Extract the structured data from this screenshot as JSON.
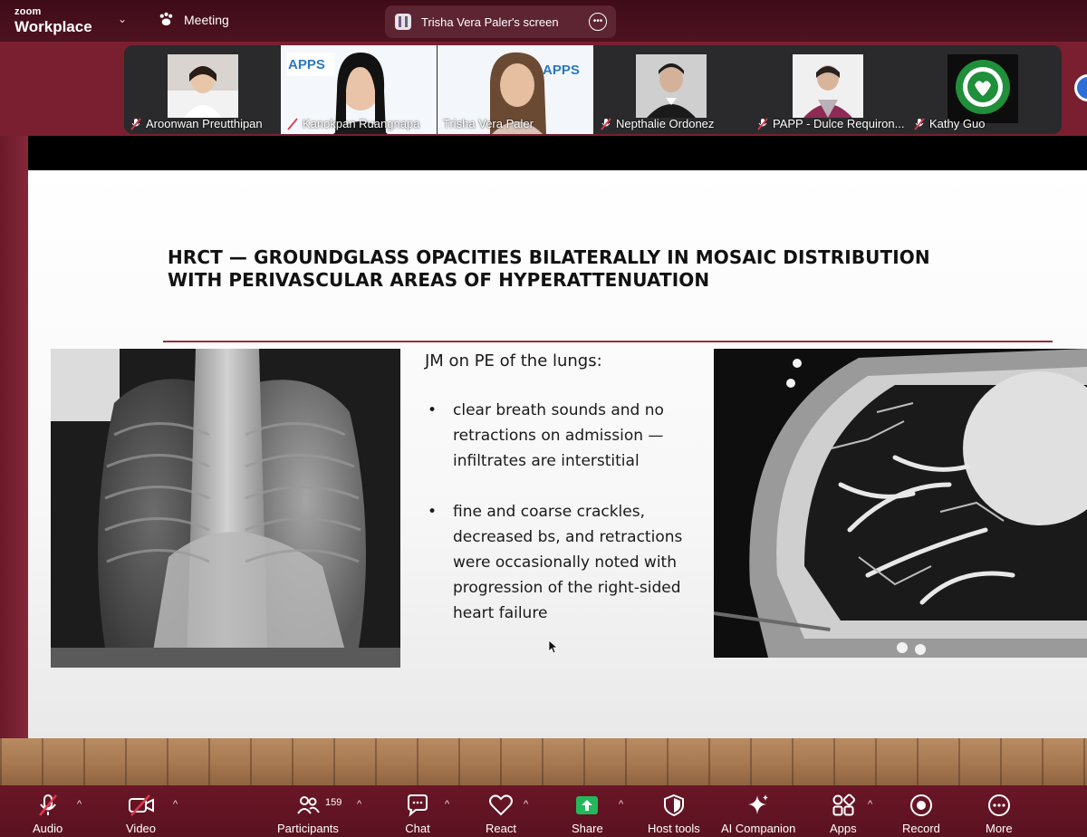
{
  "app": {
    "brand_top": "zoom",
    "brand_bottom": "Workplace",
    "meeting_label": "Meeting"
  },
  "share_banner": {
    "text": "Trisha Vera Paler's screen"
  },
  "participants_strip": [
    {
      "name": "Aroonwan Preutthipan",
      "muted": true
    },
    {
      "name": "Kanokpan Ruangnapa",
      "muted": true
    },
    {
      "name": "Trisha Vera Paler",
      "muted": false,
      "active_speaker": true
    },
    {
      "name": "Nepthalie Ordonez",
      "muted": true
    },
    {
      "name": "PAPP - Dulce Requiron...",
      "muted": true
    },
    {
      "name": "Kathy Guo",
      "muted": true
    }
  ],
  "slide": {
    "title_line1": "HRCT — GROUNDGLASS OPACITIES BILATERALLY IN MOSAIC DISTRIBUTION",
    "title_line2": "WITH PERIVASCULAR AREAS OF HYPERATTENUATION",
    "notes_heading": "JM on PE of the lungs:",
    "bullets": [
      "clear breath sounds and no retractions on admission — infiltrates are interstitial",
      "fine and coarse crackles, decreased bs, and retractions were occasionally noted with progression of the right-sided heart failure"
    ]
  },
  "toolbar": {
    "audio": "Audio",
    "video": "Video",
    "participants": "Participants",
    "participants_count": "159",
    "chat": "Chat",
    "react": "React",
    "share": "Share",
    "host_tools": "Host tools",
    "ai_companion": "AI Companion",
    "apps": "Apps",
    "record": "Record",
    "more": "More"
  },
  "colors": {
    "accent_maroon": "#7a1f30",
    "share_green": "#23b85a",
    "active_border": "#3fd07a",
    "muted_red": "#e0384d"
  }
}
